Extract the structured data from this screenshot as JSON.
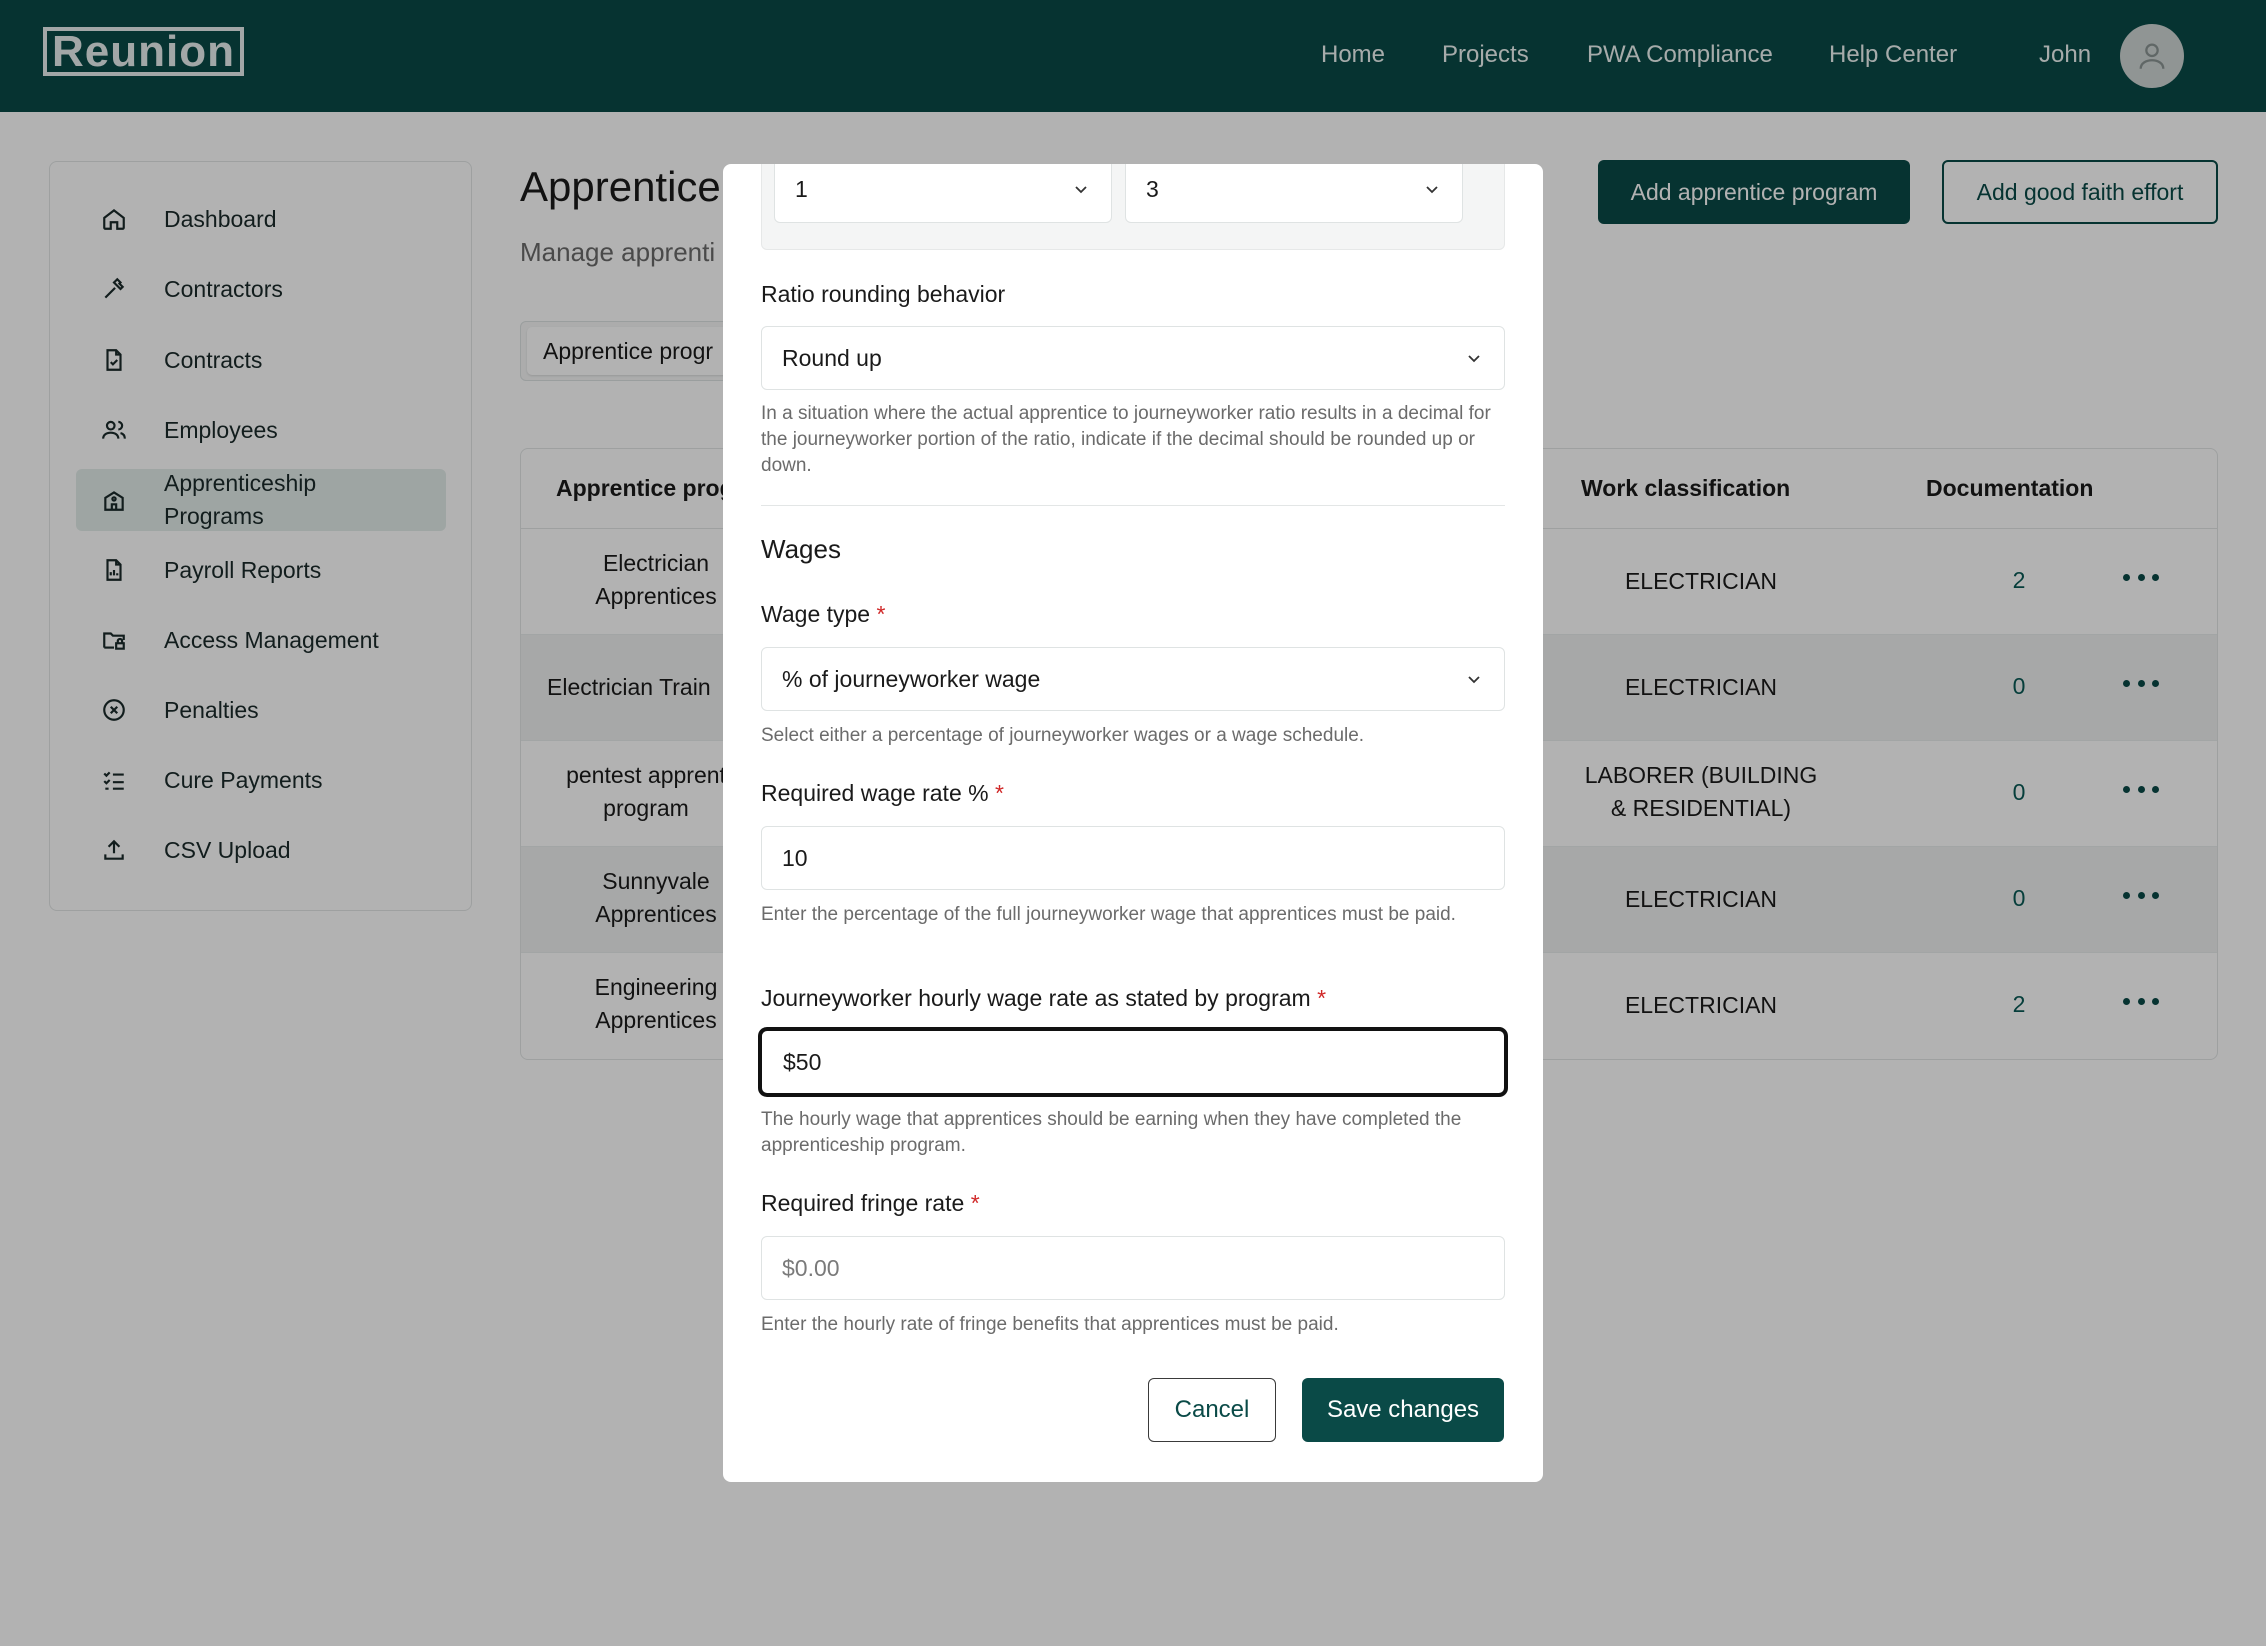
{
  "header": {
    "logo": "Reunion",
    "nav": [
      "Home",
      "Projects",
      "PWA Compliance",
      "Help Center"
    ],
    "user_name": "John"
  },
  "sidebar": {
    "items": [
      {
        "label": "Dashboard",
        "icon": "home-icon"
      },
      {
        "label": "Contractors",
        "icon": "hammer-icon"
      },
      {
        "label": "Contracts",
        "icon": "file-check-icon"
      },
      {
        "label": "Employees",
        "icon": "users-icon"
      },
      {
        "label": "Apprenticeship Programs",
        "icon": "school-icon",
        "active": true
      },
      {
        "label": "Payroll Reports",
        "icon": "file-report-icon"
      },
      {
        "label": "Access Management",
        "icon": "folder-lock-icon"
      },
      {
        "label": "Penalties",
        "icon": "circle-x-icon"
      },
      {
        "label": "Cure Payments",
        "icon": "checklist-icon"
      },
      {
        "label": "CSV Upload",
        "icon": "upload-icon"
      }
    ]
  },
  "main": {
    "title": "Apprentice",
    "subtitle": "Manage apprenti",
    "add_program_label": "Add apprentice program",
    "add_gfe_label": "Add good faith effort",
    "tab_label": "Apprentice progr"
  },
  "table": {
    "headers": {
      "program": "Apprentice prog",
      "work_classification": "Work classification",
      "documentation": "Documentation"
    },
    "rows": [
      {
        "program": "Electrician Apprentices",
        "classification": "ELECTRICIAN",
        "docs": "2"
      },
      {
        "program": "Electrician Train",
        "classification": "ELECTRICIAN",
        "docs": "0"
      },
      {
        "program": "pentest apprent program",
        "classification": "LABORER (BUILDING & RESIDENTIAL)",
        "docs": "0"
      },
      {
        "program": "Sunnyvale Apprentices",
        "classification": "ELECTRICIAN",
        "docs": "0"
      },
      {
        "program": "Engineering Apprentices",
        "classification": "ELECTRICIAN",
        "docs": "2"
      }
    ]
  },
  "modal": {
    "ratio_apprentice_value": "1",
    "ratio_journeyworker_value": "3",
    "rounding_label": "Ratio rounding behavior",
    "rounding_value": "Round up",
    "rounding_help": "In a situation where the actual apprentice to journeyworker ratio results in a decimal for the journeyworker portion of the ratio, indicate if the decimal should be rounded up or down.",
    "wages_section": "Wages",
    "wage_type_label": "Wage type",
    "wage_type_value": "% of journeyworker wage",
    "wage_type_help": "Select either a percentage of journeyworker wages or a wage schedule.",
    "wage_rate_label": "Required wage rate %",
    "wage_rate_value": "10",
    "wage_rate_help": "Enter the percentage of the full journeyworker wage that apprentices must be paid.",
    "jw_rate_label": "Journeyworker hourly wage rate as stated by program",
    "jw_rate_value": "$50",
    "jw_rate_help": "The hourly wage that apprentices should be earning when they have completed the apprenticeship program.",
    "fringe_label": "Required fringe rate",
    "fringe_placeholder": "$0.00",
    "fringe_help": "Enter the hourly rate of fringe benefits that apprentices must be paid.",
    "required_marker": "*",
    "cancel_label": "Cancel",
    "save_label": "Save changes"
  },
  "colors": {
    "brand": "#0a4a47",
    "required": "#d02828"
  }
}
